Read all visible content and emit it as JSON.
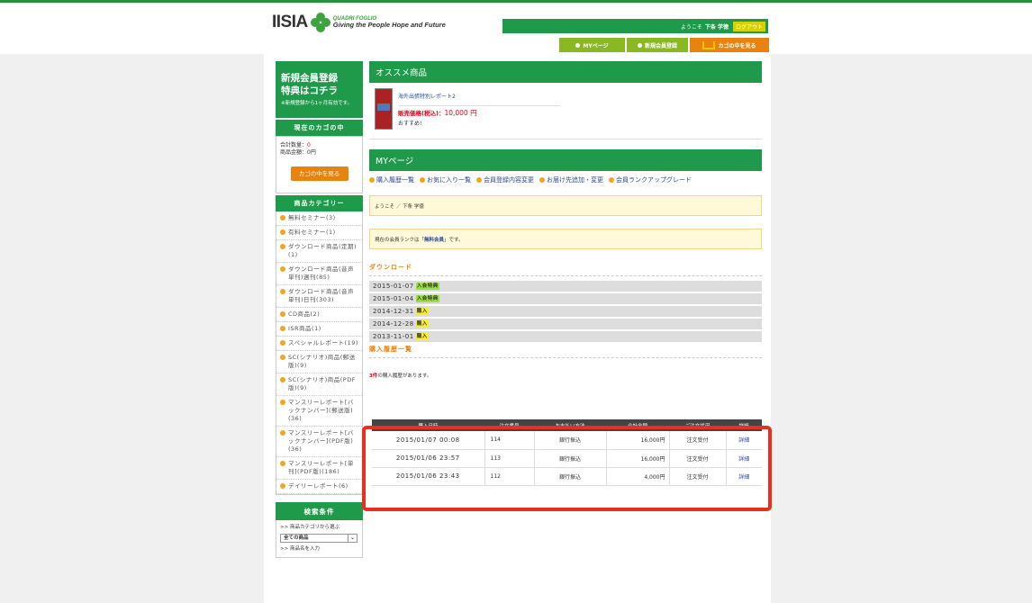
{
  "header": {
    "logo_text": "IISIA",
    "tagline_top": "QUADRI FOGLIO",
    "tagline_bottom": "Giving the People Hope and Future",
    "welcome_prefix": "ようこそ",
    "user_name": "下条 学徳",
    "logout_label": "ログアウト",
    "nav": {
      "mypage": "MYページ",
      "register": "新規会員登録",
      "cart": "カゴの中を見る"
    }
  },
  "sidebar": {
    "promo_line1": "新規会員登録",
    "promo_line2": "特典はコチラ",
    "promo_note": "※新規登録から1ヶ月有効です。",
    "cart_heading": "現在のカゴの中",
    "cart_qty_label": "合計数量：",
    "cart_qty": "0",
    "cart_amount_label": "商品金額：",
    "cart_amount": "0円",
    "cart_button": "カゴの中を見る",
    "category_heading": "商品カテゴリー",
    "categories": [
      "無料セミナー(3)",
      "有料セミナー(1)",
      "ダウンロード商品(定期)(1)",
      "ダウンロード商品(音声単刊)週刊(85)",
      "ダウンロード商品(音声単刊)日刊(303)",
      "CD商品(2)",
      "ISR商品(1)",
      "スペシャルレポート(19)",
      "SC(シナリオ)商品(郵送版)(9)",
      "SC(シナリオ)商品(PDF版)(9)",
      "マンスリーレポート[バックナンバー](郵送版)(36)",
      "マンスリーレポート[バックナンバー](PDF版)(36)",
      "マンスリーレポート[単刊](PDF版)(186)",
      "デイリーレポート(6)"
    ],
    "search_heading": "検索条件",
    "search_category_label": ">> 商品カテゴリから選ぶ",
    "search_category_value": "全ての商品",
    "search_name_label": ">> 商品名を入力"
  },
  "recommend": {
    "heading": "オススメ商品",
    "title": "海外出張特別レポート2",
    "price_label": "販売価格(税込)：",
    "price": "10,000 円",
    "note": "おすすめ!"
  },
  "mypage": {
    "heading": "MYページ",
    "menu": [
      "購入履歴一覧",
      "お気に入り一覧",
      "会員登録内容変更",
      "お届け先追加・変更",
      "会員ランクアップグレード"
    ],
    "welcome": "ようこそ ／ 下条 学徳",
    "rank_prefix": "現在の会員ランクは「",
    "rank": "無料会員",
    "rank_suffix": "」です。"
  },
  "download": {
    "heading": "ダウンロード",
    "rows": [
      {
        "date": "2015-01-07",
        "badge": "入会特典",
        "color": "green"
      },
      {
        "date": "2015-01-04",
        "badge": "入会特典",
        "color": "green"
      },
      {
        "date": "2014-12-31",
        "badge": "購入",
        "color": "yellow"
      },
      {
        "date": "2014-12-28",
        "badge": "購入",
        "color": "yellow"
      },
      {
        "date": "2013-11-01",
        "badge": "購入",
        "color": "yellow"
      }
    ]
  },
  "history": {
    "heading": "購入履歴一覧",
    "count": "3件",
    "count_suffix": "の購入履歴があります。",
    "columns": [
      "購入日時",
      "注文番号",
      "お支払い方法",
      "合計金額",
      "ご注文状況",
      "詳細"
    ],
    "rows": [
      {
        "date": "2015/01/07 00:08",
        "id": "114",
        "method": "銀行振込",
        "total": "16,000円",
        "status": "注文受付",
        "link": "詳細"
      },
      {
        "date": "2015/01/06 23:57",
        "id": "113",
        "method": "銀行振込",
        "total": "16,000円",
        "status": "注文受付",
        "link": "詳細"
      },
      {
        "date": "2015/01/06 23:43",
        "id": "112",
        "method": "銀行振込",
        "total": "4,000円",
        "status": "注文受付",
        "link": "詳細"
      }
    ]
  },
  "colors": {
    "brand_green": "#1f9a4a",
    "accent_orange": "#e8830f",
    "highlight_red": "#e8301e"
  }
}
